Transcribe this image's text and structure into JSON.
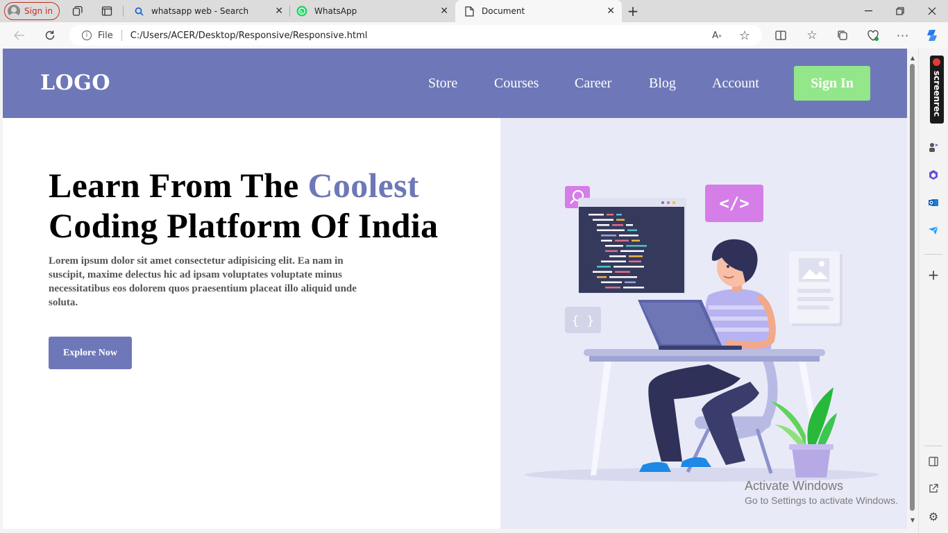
{
  "browser": {
    "profile_label": "Sign in",
    "tabs": [
      {
        "title": "whatsapp web - Search",
        "icon": "search-icon"
      },
      {
        "title": "WhatsApp",
        "icon": "whatsapp-icon"
      },
      {
        "title": "Document",
        "icon": "document-icon",
        "active": true
      }
    ],
    "address": {
      "scheme_label": "File",
      "url": "C:/Users/ACER/Desktop/Responsive/Responsive.html"
    },
    "sidebar_extension_label": "screenrec"
  },
  "site": {
    "logo": "LOGO",
    "nav": [
      "Store",
      "Courses",
      "Career",
      "Blog",
      "Account"
    ],
    "signin_label": "Sign In",
    "hero": {
      "title_part1": "Learn From The ",
      "title_highlight": "Coolest",
      "title_part2": "Coding Platform Of India",
      "text": "Lorem ipsum dolor sit amet consectetur adipisicing elit. Ea nam in suscipit, maxime delectus hic ad ipsam voluptates voluptate minus necessitatibus eos dolorem quos praesentium placeat illo aliquid unde soluta.",
      "cta_label": "Explore Now"
    },
    "illustration_code_tag": "</>",
    "illustration_braces": "{ }"
  },
  "os": {
    "watermark_title": "Activate Windows",
    "watermark_sub": "Go to Settings to activate Windows."
  },
  "colors": {
    "brand": "#6e78b8",
    "signin_green": "#93e68a",
    "hero_bg": "#e9eaf7"
  }
}
